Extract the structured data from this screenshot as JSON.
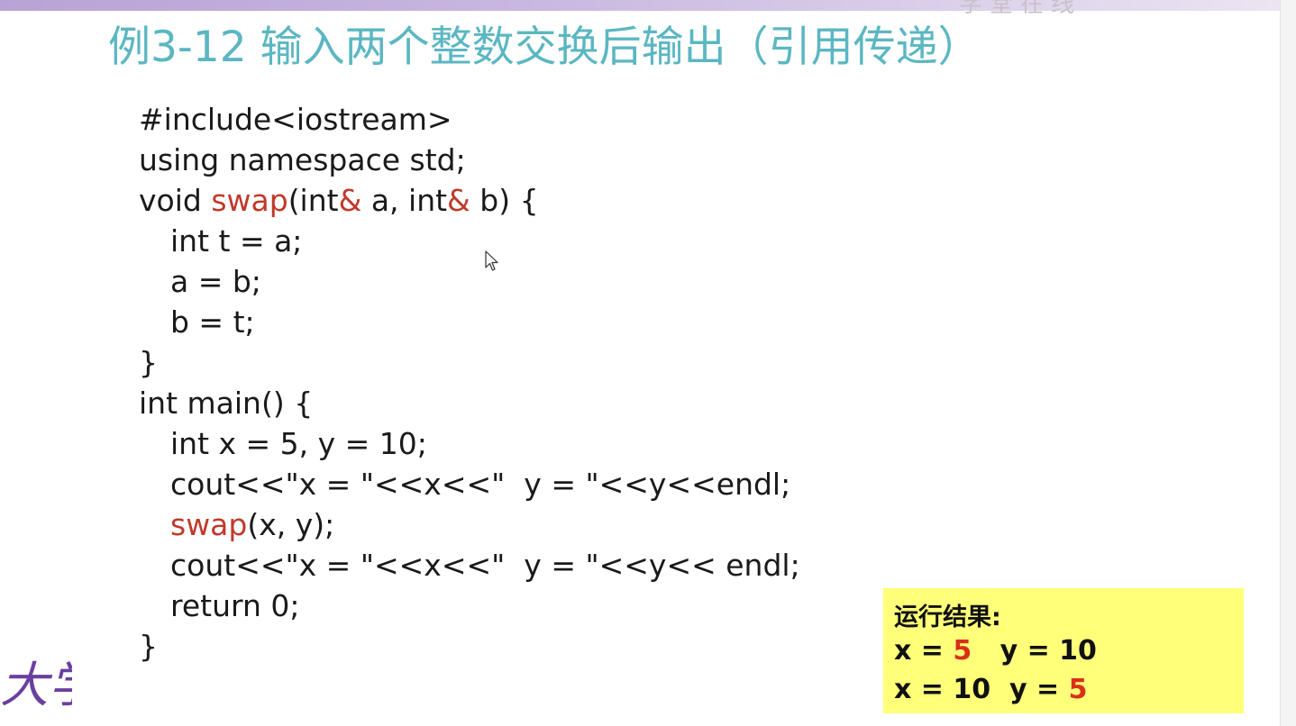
{
  "slide": {
    "title": "例3-12 输入两个整数交换后输出（引用传递）",
    "code": {
      "line1": "#include<iostream>",
      "line2": "using namespace std;",
      "line3_pre": "void ",
      "line3_swap": "swap",
      "line3_mid1": "(int",
      "line3_amp1": "&",
      "line3_mid2": " a, int",
      "line3_amp2": "&",
      "line3_post": " b) {",
      "line4": "int t = a;",
      "line5": "a = b;",
      "line6": "b = t;",
      "line7": "}",
      "line8": "int main() {",
      "line9": "int x = 5, y = 10;",
      "line10": "cout<<\"x = \"<<x<<\"  y = \"<<y<<endl;",
      "line11_swap": "swap",
      "line11_post": "(x, y);",
      "line12": "cout<<\"x = \"<<x<<\"  y = \"<<y<< endl;",
      "line13": "return 0;",
      "line14": "}"
    },
    "result": {
      "title": "运行结果:",
      "row1_a": "x = ",
      "row1_x": "5",
      "row1_b": "   y = 10",
      "row2_a": "x = 10  y = ",
      "row2_y": "5"
    },
    "watermark_text": "大学",
    "logo_text": "学堂在线"
  },
  "colors": {
    "title": "#5bb7c2",
    "keyword_red": "#c0392b",
    "result_bg": "#ffff7a",
    "result_red": "#d9301a",
    "top_bar": "#b8a3d6"
  }
}
